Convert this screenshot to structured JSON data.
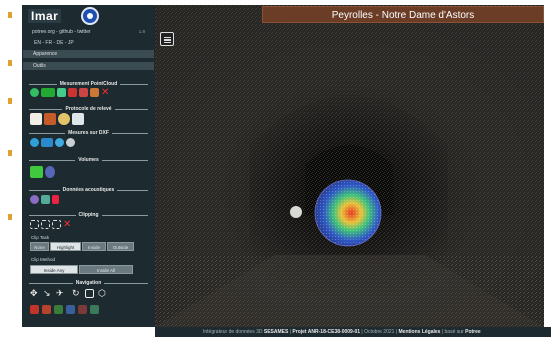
{
  "app": {
    "logo_text": "Imar",
    "view_title": "Peyrolles - Notre Dame d'Astors"
  },
  "sidebar": {
    "links": "potree.org - github - twitter",
    "version": "1.8",
    "languages": "EN - FR - DE - JP",
    "menu": [
      "Apparence",
      "Outils"
    ],
    "sections": {
      "measure": "Mesurement PointCloud",
      "protocol": "Protocole de relevé",
      "dxf": "Mesures sur DXF",
      "volumes": "Volumes",
      "acoustic": "Données acoustiques",
      "clipping": "Clipping",
      "navigation": "Navigation"
    },
    "clip_task_label": "Clip Task",
    "clip_task_options": [
      "None",
      "Highlight",
      "Inside",
      "Outside"
    ],
    "clip_task_selected": "Highlight",
    "clip_method_label": "Clip Method",
    "clip_method_options": [
      "Inside Any",
      "Inside All"
    ],
    "clip_method_selected": "Inside Any"
  },
  "footer": {
    "prefix": "Intégrateur de données 3D",
    "sesames": "SESAMES",
    "sep1": " | ",
    "project": "Projet ANR-18-CE38-0009-01",
    "sep2": " | Octobre 2021 | ",
    "legal": "Mentions Légales",
    "sep3": " | basé sur ",
    "potree": "Potree"
  },
  "colors": {
    "sidebar_bg": "#1d2a2f",
    "title_bg": "#6b3d27",
    "accent_orange": "#e0a030"
  }
}
